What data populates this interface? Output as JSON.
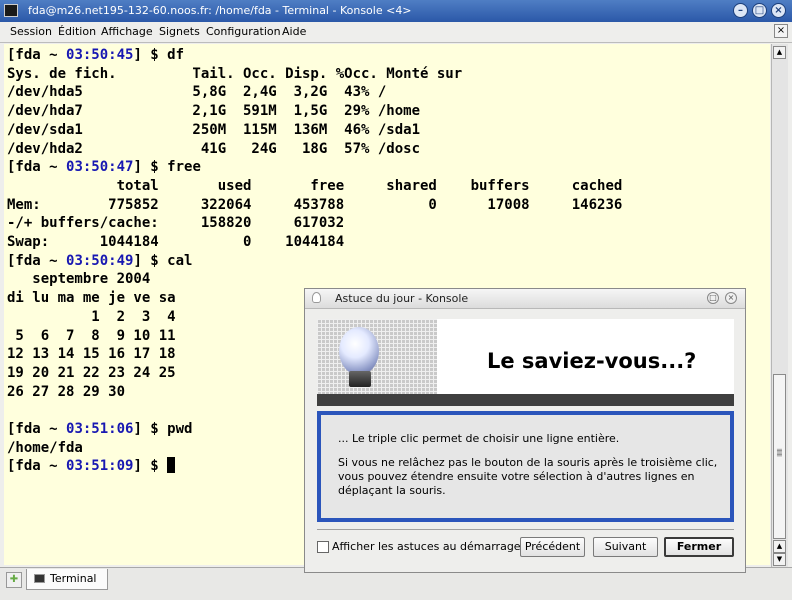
{
  "window": {
    "title": "fda@m26.net195-132-60.noos.fr: /home/fda - Terminal - Konsole <4>",
    "minimize_icon": "minimize-icon",
    "maximize_icon": "maximize-icon",
    "close_icon": "close-icon"
  },
  "menu": [
    "Session",
    "Édition",
    "Affichage",
    "Signets",
    "Configuration",
    "Aide"
  ],
  "terminal": {
    "lines": [
      [
        {
          "t": "[fda ~ "
        },
        {
          "t": "03:50:45",
          "c": "blue"
        },
        {
          "t": "] $ df"
        }
      ],
      [
        {
          "t": "Sys. de fich.         Tail. Occ. Disp. %Occ. Monté sur"
        }
      ],
      [
        {
          "t": "/dev/hda5             5,8G  2,4G  3,2G  43% /"
        }
      ],
      [
        {
          "t": "/dev/hda7             2,1G  591M  1,5G  29% /home"
        }
      ],
      [
        {
          "t": "/dev/sda1             250M  115M  136M  46% /sda1"
        }
      ],
      [
        {
          "t": "/dev/hda2              41G   24G   18G  57% /dosc"
        }
      ],
      [
        {
          "t": "[fda ~ "
        },
        {
          "t": "03:50:47",
          "c": "blue"
        },
        {
          "t": "] $ free"
        }
      ],
      [
        {
          "t": "             total       used       free     shared    buffers     cached"
        }
      ],
      [
        {
          "t": "Mem:        775852     322064     453788          0      17008     146236"
        }
      ],
      [
        {
          "t": "-/+ buffers/cache:     158820     617032"
        }
      ],
      [
        {
          "t": "Swap:      1044184          0    1044184"
        }
      ],
      [
        {
          "t": "[fda ~ "
        },
        {
          "t": "03:50:49",
          "c": "blue"
        },
        {
          "t": "] $ cal"
        }
      ],
      [
        {
          "t": "   septembre 2004"
        }
      ],
      [
        {
          "t": "di lu ma me je ve sa"
        }
      ],
      [
        {
          "t": "          1  2  3  4"
        }
      ],
      [
        {
          "t": " 5  6  7  8  9 10 11"
        }
      ],
      [
        {
          "t": "12 13 14 15 16 17 18"
        }
      ],
      [
        {
          "t": "19 20 21 22 23 24 25"
        }
      ],
      [
        {
          "t": "26 27 28 29 30"
        }
      ],
      [
        {
          "t": ""
        }
      ],
      [
        {
          "t": "[fda ~ "
        },
        {
          "t": "03:51:06",
          "c": "blue"
        },
        {
          "t": "] $ pwd"
        }
      ],
      [
        {
          "t": "/home/fda"
        }
      ],
      [
        {
          "t": "[fda ~ "
        },
        {
          "t": "03:51:09",
          "c": "blue"
        },
        {
          "t": "] $ "
        }
      ]
    ]
  },
  "tabs": {
    "new_tab_icon": "new-session-icon",
    "items": [
      {
        "label": "Terminal",
        "icon": "terminal-icon"
      }
    ]
  },
  "dialog": {
    "title": "Astuce du jour - Konsole",
    "headline": "Le saviez-vous...?",
    "tip_paragraph_1": "... Le triple clic permet de choisir une ligne entière.",
    "tip_paragraph_2": "Si vous ne relâchez pas le bouton de la souris après le troisième clic, vous pouvez étendre ensuite votre sélection à d'autres lignes en déplaçant la souris.",
    "checkbox_label": "Afficher les astuces au démarrage",
    "checkbox_checked": false,
    "buttons": {
      "previous": "Précédent",
      "next": "Suivant",
      "close": "Fermer"
    }
  },
  "colors": {
    "terminal_bg": "#ffffdd",
    "prompt_time": "#1818b2",
    "titlebar": "#3a67b6",
    "tip_border": "#2b55bb"
  }
}
